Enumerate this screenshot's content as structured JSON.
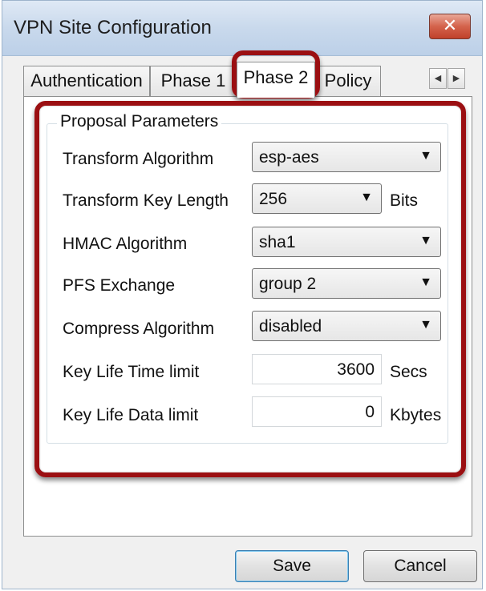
{
  "window": {
    "title": "VPN Site Configuration",
    "close_symbol": "✕"
  },
  "tabs": [
    {
      "label": "Authentication",
      "active": false
    },
    {
      "label": "Phase 1",
      "active": false
    },
    {
      "label": "Phase 2",
      "active": true
    },
    {
      "label": "Policy",
      "active": false
    }
  ],
  "tab_scroll": {
    "left_symbol": "◀",
    "right_symbol": "▶"
  },
  "proposal": {
    "group_title": "Proposal Parameters",
    "transform_algorithm": {
      "label": "Transform Algorithm",
      "value": "esp-aes"
    },
    "transform_key_length": {
      "label": "Transform Key Length",
      "value": "256",
      "unit": "Bits"
    },
    "hmac_algorithm": {
      "label": "HMAC Algorithm",
      "value": "sha1"
    },
    "pfs_exchange": {
      "label": "PFS Exchange",
      "value": "group 2"
    },
    "compress_algorithm": {
      "label": "Compress Algorithm",
      "value": "disabled"
    },
    "key_life_time": {
      "label": "Key Life Time limit",
      "value": "3600",
      "unit": "Secs"
    },
    "key_life_data": {
      "label": "Key Life Data limit",
      "value": "0",
      "unit": "Kbytes"
    }
  },
  "dropdown_arrow": "▼",
  "buttons": {
    "save": "Save",
    "cancel": "Cancel"
  },
  "colors": {
    "highlight": "#9b0f12",
    "close_button": "#c94a35"
  }
}
